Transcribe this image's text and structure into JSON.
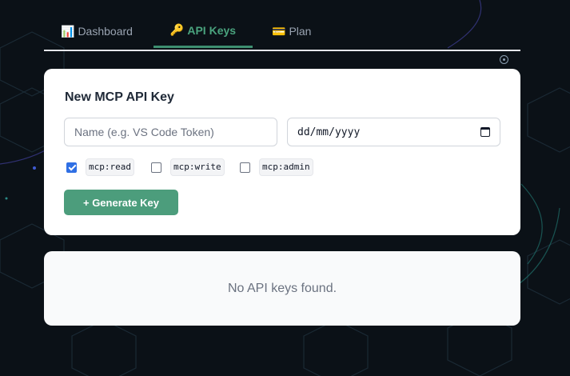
{
  "tabs": [
    {
      "icon": "📊",
      "label": "Dashboard",
      "active": false
    },
    {
      "icon": "🔑",
      "label": "API Keys",
      "active": true
    },
    {
      "icon": "💳",
      "label": "Plan",
      "active": false
    }
  ],
  "new_key": {
    "title": "New MCP API Key",
    "name_placeholder": "Name (e.g. VS Code Token)",
    "name_value": "",
    "date_value": "dd/mm/yyyy",
    "scopes": [
      {
        "label": "mcp:read",
        "checked": true
      },
      {
        "label": "mcp:write",
        "checked": false
      },
      {
        "label": "mcp:admin",
        "checked": false
      }
    ],
    "generate_label": "+ Generate Key"
  },
  "keys_list": {
    "empty_message": "No API keys found."
  },
  "colors": {
    "accent": "#4c9d7c",
    "active_tab": "#4aa37e",
    "background": "#0b1117",
    "checkbox": "#2f6fe4"
  }
}
